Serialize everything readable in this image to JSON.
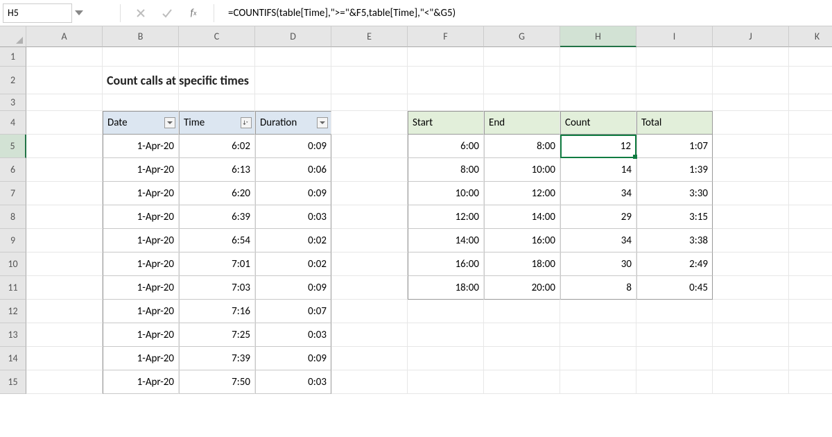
{
  "name_box": "H5",
  "formula": "=COUNTIFS(table[Time],\">=\"&F5,table[Time],\"<\"&G5)",
  "columns": [
    "A",
    "B",
    "C",
    "D",
    "E",
    "F",
    "G",
    "H",
    "I",
    "J",
    "K"
  ],
  "rows": [
    "1",
    "2",
    "3",
    "4",
    "5",
    "6",
    "7",
    "8",
    "9",
    "10",
    "11",
    "12",
    "13",
    "14",
    "15"
  ],
  "title": "Count calls at specific times",
  "table1": {
    "headers": [
      "Date",
      "Time",
      "Duration"
    ],
    "rows": [
      {
        "date": "1-Apr-20",
        "time": "6:02",
        "dur": "0:09"
      },
      {
        "date": "1-Apr-20",
        "time": "6:13",
        "dur": "0:06"
      },
      {
        "date": "1-Apr-20",
        "time": "6:20",
        "dur": "0:09"
      },
      {
        "date": "1-Apr-20",
        "time": "6:39",
        "dur": "0:03"
      },
      {
        "date": "1-Apr-20",
        "time": "6:54",
        "dur": "0:02"
      },
      {
        "date": "1-Apr-20",
        "time": "7:01",
        "dur": "0:02"
      },
      {
        "date": "1-Apr-20",
        "time": "7:03",
        "dur": "0:09"
      },
      {
        "date": "1-Apr-20",
        "time": "7:16",
        "dur": "0:07"
      },
      {
        "date": "1-Apr-20",
        "time": "7:25",
        "dur": "0:03"
      },
      {
        "date": "1-Apr-20",
        "time": "7:39",
        "dur": "0:09"
      },
      {
        "date": "1-Apr-20",
        "time": "7:50",
        "dur": "0:03"
      }
    ]
  },
  "table2": {
    "headers": [
      "Start",
      "End",
      "Count",
      "Total"
    ],
    "rows": [
      {
        "start": "6:00",
        "end": "8:00",
        "count": "12",
        "total": "1:07"
      },
      {
        "start": "8:00",
        "end": "10:00",
        "count": "14",
        "total": "1:39"
      },
      {
        "start": "10:00",
        "end": "12:00",
        "count": "34",
        "total": "3:30"
      },
      {
        "start": "12:00",
        "end": "14:00",
        "count": "29",
        "total": "3:15"
      },
      {
        "start": "14:00",
        "end": "16:00",
        "count": "34",
        "total": "3:38"
      },
      {
        "start": "16:00",
        "end": "18:00",
        "count": "30",
        "total": "2:49"
      },
      {
        "start": "18:00",
        "end": "20:00",
        "count": "8",
        "total": "0:45"
      }
    ]
  },
  "active_cell": {
    "col": "H",
    "row": "5"
  }
}
